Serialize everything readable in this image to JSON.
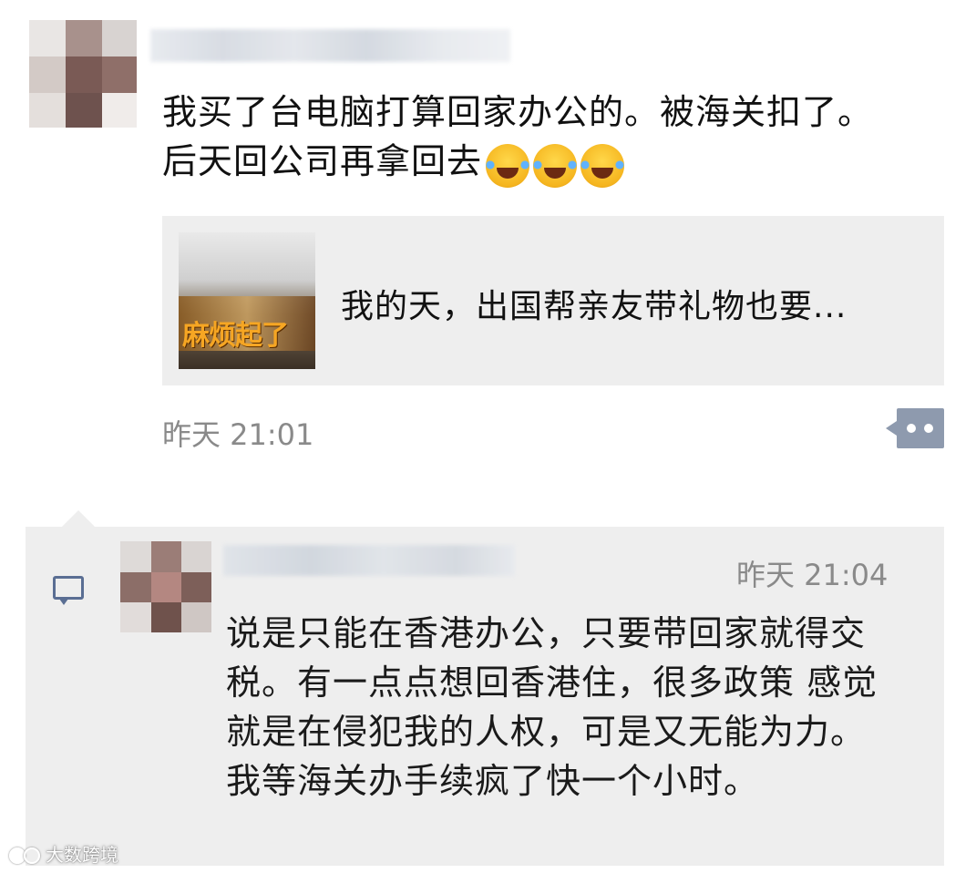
{
  "post": {
    "text_line1": "我买了台电脑打算回家办公的。被海关扣了。",
    "text_line2": "后天回公司再拿回去",
    "emoji_count": 3,
    "emoji_icon": "face-with-tears-of-joy",
    "share_card": {
      "thumb_caption": "麻烦起了",
      "title": "我的天，出国帮亲友带礼物也要..."
    },
    "time": "昨天 21:01",
    "more_icon": "more-dots-icon"
  },
  "comment": {
    "time": "昨天 21:04",
    "text": "说是只能在香港办公，只要带回家就得交税。有一点点想回香港住，很多政策 感觉就是在侵犯我的人权，可是又无能为力。我等海关办手续疯了快一个小时。",
    "icon": "comment-icon"
  },
  "watermark": {
    "text": "大数跨境"
  },
  "colors": {
    "card_bg": "#eeeeee",
    "time_text": "#8a8a8a",
    "more_button": "#8e9aae",
    "comment_icon": "#5a6e93"
  }
}
